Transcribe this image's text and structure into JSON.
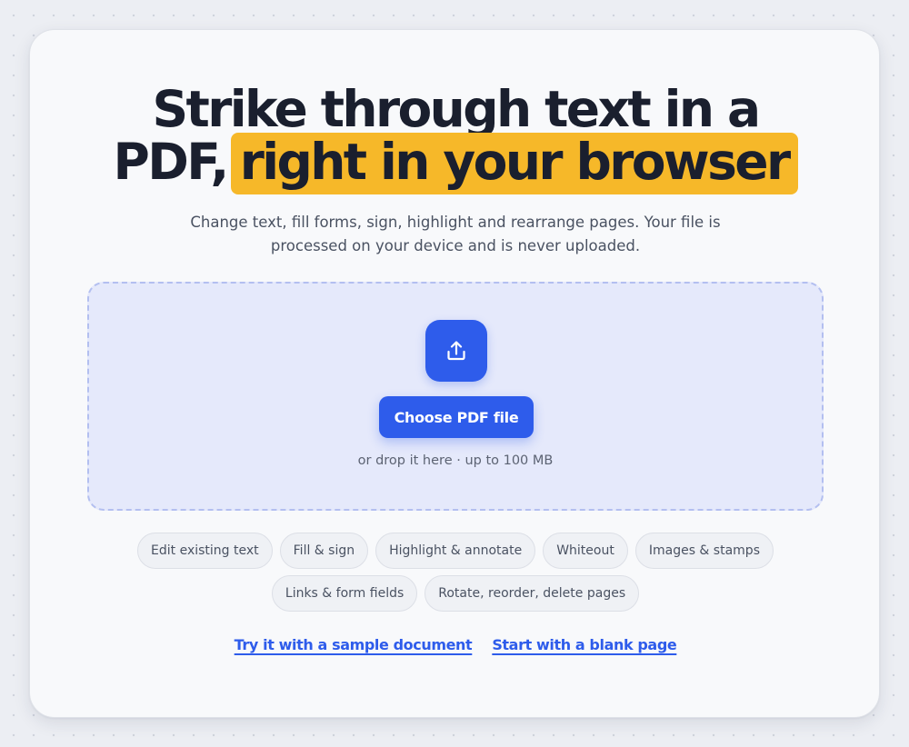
{
  "hero": {
    "title_line1": "Strike through text in a",
    "title_line2_plain": "PDF,",
    "title_line2_highlight": "right in your browser",
    "highlight_color": "#f6b829",
    "subtitle": "Change text, fill forms, sign, highlight and rearrange pages. Your file is processed on your device and is never uploaded."
  },
  "dropzone": {
    "icon": "upload-icon",
    "button_label": "Choose PDF file",
    "hint": "or drop it here · up to 100 MB",
    "accent_color": "#2e5ceb"
  },
  "features": {
    "row1": [
      "Edit existing text",
      "Fill & sign",
      "Highlight & annotate",
      "Whiteout",
      "Images & stamps"
    ],
    "row2": [
      "Links & form fields",
      "Rotate, reorder, delete pages"
    ]
  },
  "links": {
    "sample": "Try it with a sample document",
    "blank": "Start with a blank page"
  }
}
